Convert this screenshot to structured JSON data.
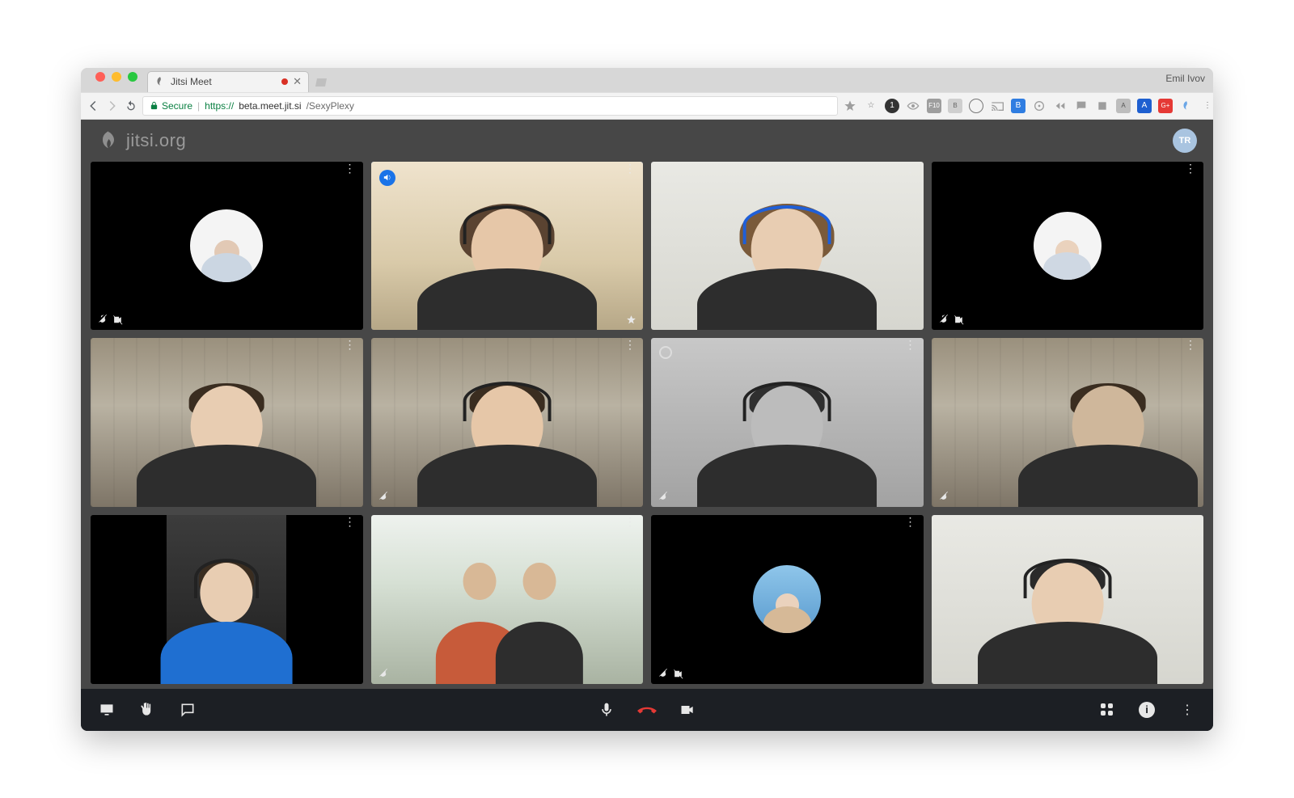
{
  "tab": {
    "title": "Jitsi Meet",
    "favicon": "jitsi-icon",
    "recording": true,
    "profile_name": "Emil Ivov"
  },
  "url": {
    "secure_label": "Secure",
    "scheme": "https://",
    "host": "beta.meet.jit.si",
    "path": "/SexyPlexy"
  },
  "extensions": [
    "star",
    "circle-1",
    "eye",
    "f10",
    "b-square",
    "ring",
    "cast",
    "b-blue",
    "target",
    "rewind",
    "chat",
    "box",
    "a-square",
    "a-blue",
    "g-red",
    "feather",
    "menu"
  ],
  "app": {
    "logo_text": "jitsi.org",
    "user_initials": "TR"
  },
  "tiles": [
    {
      "id": 0,
      "video": false,
      "avatar": true,
      "muted_mic": true,
      "muted_cam": true,
      "menu": true
    },
    {
      "id": 1,
      "video": true,
      "active_speaker": true,
      "speaking_badge": true,
      "pin": true,
      "menu": true,
      "scene": "room-warm"
    },
    {
      "id": 2,
      "video": true,
      "menu": true,
      "scene": "plain-wall",
      "headset_blue": true
    },
    {
      "id": 3,
      "video": false,
      "avatar": true,
      "muted_mic": true,
      "muted_cam": true,
      "menu": true
    },
    {
      "id": 4,
      "video": true,
      "menu": true,
      "scene": "office"
    },
    {
      "id": 5,
      "video": true,
      "muted_mic": true,
      "menu": true,
      "scene": "office"
    },
    {
      "id": 6,
      "video": true,
      "ring_badge": true,
      "muted_mic": true,
      "menu": true,
      "scene": "room-gray"
    },
    {
      "id": 7,
      "video": true,
      "muted_mic": true,
      "menu": true,
      "scene": "office"
    },
    {
      "id": 8,
      "video": true,
      "narrow": true,
      "menu": true,
      "scene": "room-dark",
      "shirt": "blue"
    },
    {
      "id": 9,
      "video": true,
      "muted_mic": true,
      "menu": true,
      "scene": "bright-office"
    },
    {
      "id": 10,
      "video": false,
      "avatar": true,
      "avatar_photo": true,
      "muted_mic": true,
      "muted_cam": true,
      "menu": true
    },
    {
      "id": 11,
      "video": true,
      "menu": true,
      "scene": "plain-wall"
    }
  ],
  "toolbar": {
    "left": [
      "screenshare",
      "raise-hand",
      "chat"
    ],
    "center": [
      "mic",
      "hangup",
      "camera"
    ],
    "right": [
      "tile-view",
      "info",
      "more"
    ]
  }
}
